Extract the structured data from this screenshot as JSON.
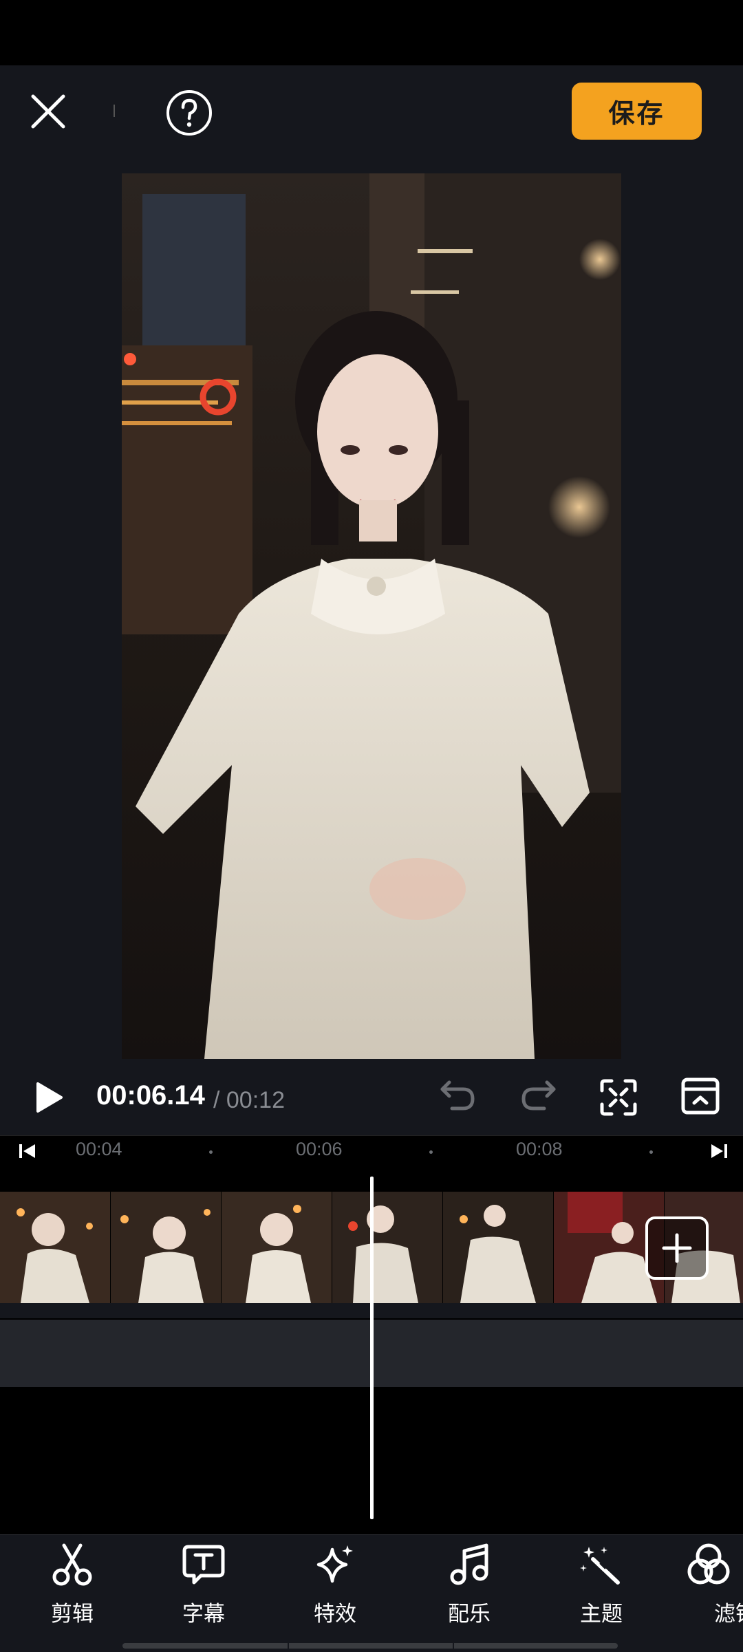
{
  "header": {
    "save_label": "保存"
  },
  "player": {
    "current_time": "00:06.14",
    "total_time": "/ 00:12"
  },
  "timeline": {
    "ticks": [
      "00:04",
      "00:06",
      "00:08"
    ]
  },
  "toolbar": {
    "items": [
      {
        "label": "剪辑",
        "icon": "scissors-icon"
      },
      {
        "label": "字幕",
        "icon": "text-icon"
      },
      {
        "label": "特效",
        "icon": "sparkle-icon"
      },
      {
        "label": "配乐",
        "icon": "music-note-icon"
      },
      {
        "label": "主题",
        "icon": "magic-wand-icon"
      },
      {
        "label": "滤镜",
        "icon": "filter-icon"
      }
    ]
  },
  "colors": {
    "accent": "#f4a21f",
    "background": "#15171d"
  }
}
